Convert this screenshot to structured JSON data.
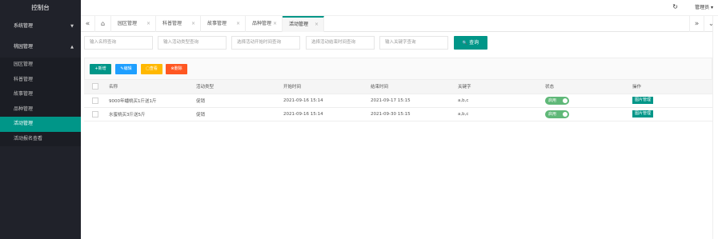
{
  "sidebar": {
    "title": "控制台",
    "groups": [
      {
        "label": "系统管理",
        "caret": "▼"
      },
      {
        "label": "桃园管理",
        "caret": "▲"
      }
    ],
    "items": [
      {
        "label": "园区管理"
      },
      {
        "label": "科普管理"
      },
      {
        "label": "故事管理"
      },
      {
        "label": "品种管理"
      },
      {
        "label": "活动管理"
      },
      {
        "label": "活动报名查看"
      }
    ]
  },
  "header": {
    "refresh_icon": "↻",
    "user_label": "管理员 ▾"
  },
  "tabs": {
    "left_nav": "«",
    "right_nav": "»",
    "home_icon": "⌂",
    "close": "×",
    "dropdown_icon": "⌄",
    "items": [
      {
        "label": "园区管理"
      },
      {
        "label": "科普管理"
      },
      {
        "label": "故事管理"
      },
      {
        "label": "品种管理"
      },
      {
        "label": "活动管理"
      }
    ]
  },
  "filters": {
    "name_placeholder": "输入名称查询",
    "type_placeholder": "输入活动类型查询",
    "start_placeholder": "选择活动开始时间查询",
    "end_placeholder": "选择活动结束时间查询",
    "keyword_placeholder": "输入关键字查询",
    "search_label": "查询",
    "search_icon": "🔍"
  },
  "toolbar": {
    "add_label": "+新增",
    "edit_label": "✎编辑",
    "view_label": "▢查看",
    "delete_label": "⊗删除",
    "colors": {
      "add": "#009688",
      "edit": "#1e9fff",
      "view": "#ffb800",
      "delete": "#ff5722"
    }
  },
  "table": {
    "headers": [
      "名称",
      "活动类型",
      "开始时间",
      "结束时间",
      "关键字",
      "状态",
      "操作"
    ],
    "rows": [
      {
        "name": "9000年蟠桃买1斤送1斤",
        "type": "促销",
        "start": "2021-09-16 15:14",
        "end": "2021-09-17 15:15",
        "keywords": "a,b,c",
        "status": "启用",
        "action": "图片管理"
      },
      {
        "name": "水蜜桃买3斤送5斤",
        "type": "促销",
        "start": "2021-09-16 15:14",
        "end": "2021-09-30 15:15",
        "keywords": "a,b,c",
        "status": "启用",
        "action": "图片管理"
      }
    ]
  }
}
